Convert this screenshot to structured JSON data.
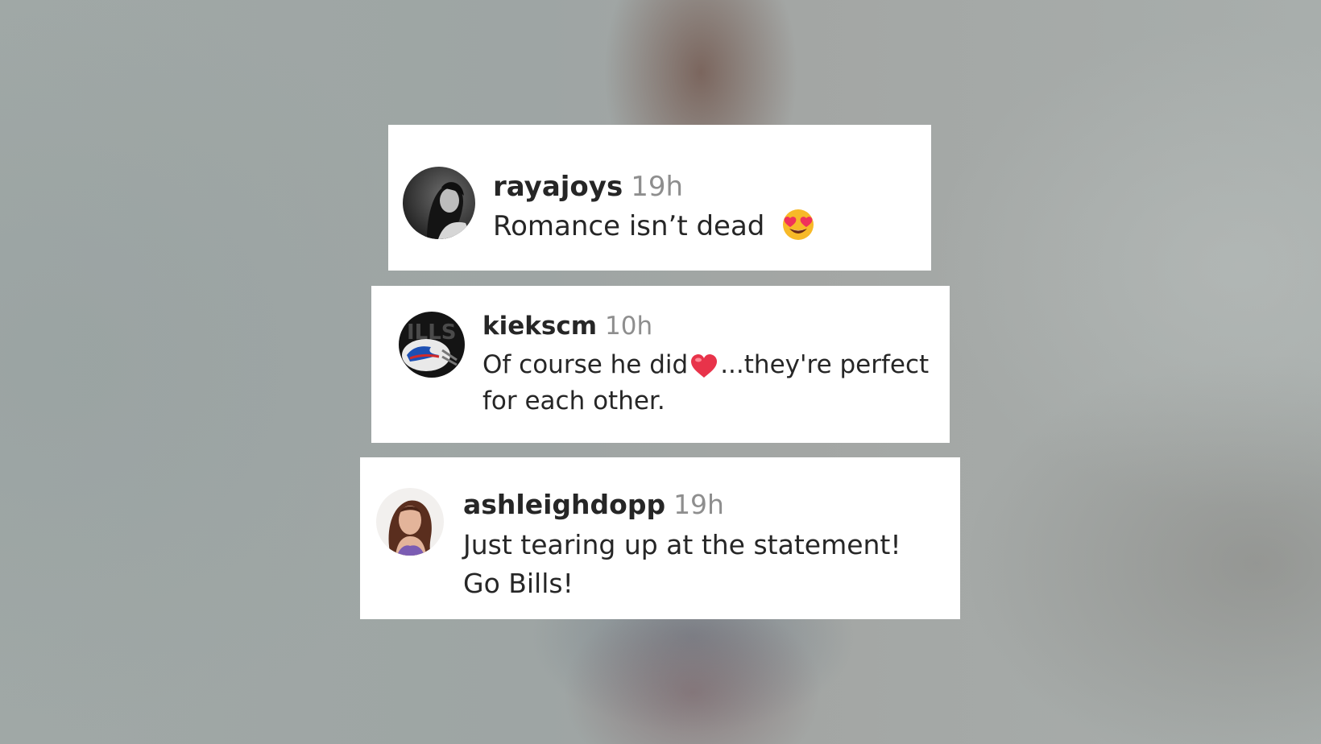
{
  "comments": [
    {
      "username": "rayajoys",
      "time": "19h",
      "text": "Romance isn’t dead",
      "emoji": "heart-eyes-emoji",
      "avatar": "grayscale-portrait-avatar"
    },
    {
      "username": "kiekscm",
      "time": "10h",
      "text_before": "Of course he did",
      "emoji": "red-heart-emoji",
      "text_after": "...they're perfect for each other.",
      "avatar": "bills-helmet-avatar"
    },
    {
      "username": "ashleighdopp",
      "time": "19h",
      "text": "Just tearing up at the statement! Go Bills!",
      "avatar": "woman-portrait-avatar"
    }
  ],
  "colors": {
    "username": "#262626",
    "timestamp": "#8e8e8e",
    "card": "#ffffff",
    "heart": "#e8334a",
    "emoji_face": "#f7b928"
  }
}
